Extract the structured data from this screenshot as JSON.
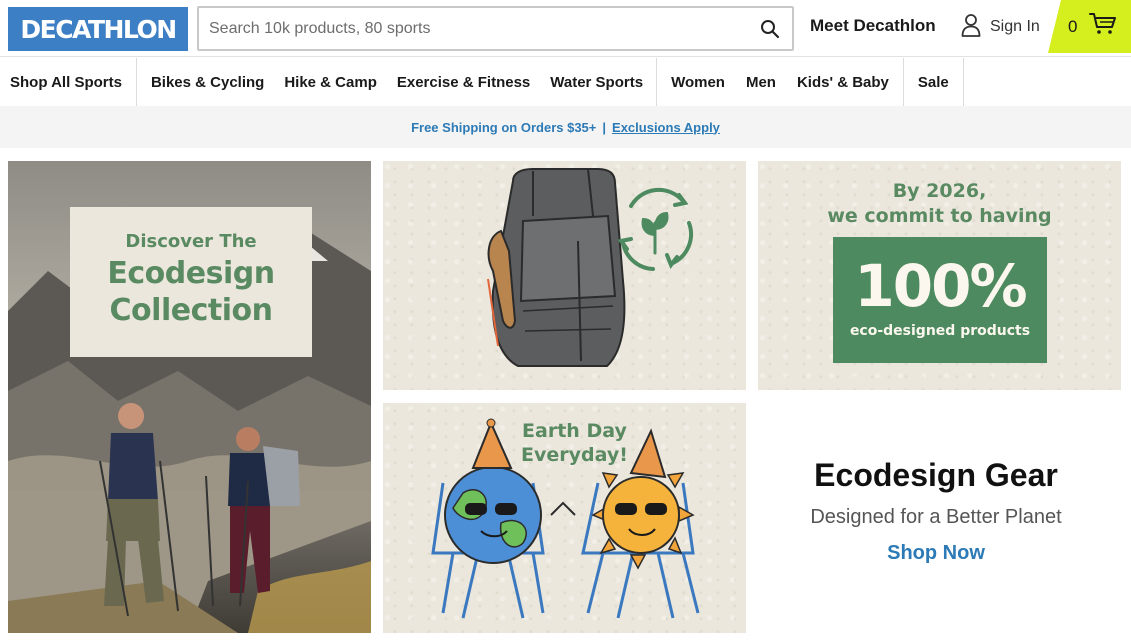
{
  "brand": {
    "logo_text": "DECATHLON",
    "accent": "#3d7fc4",
    "cart_color": "#d4ee1e"
  },
  "header": {
    "search_placeholder": "Search 10k products, 80 sports",
    "search_icon": "search-icon",
    "meet": "Meet Decathlon",
    "signin": "Sign In",
    "user_icon": "user-icon",
    "cart_count": "0",
    "cart_icon": "cart-icon"
  },
  "nav": {
    "items": [
      "Shop All Sports",
      "Bikes & Cycling",
      "Hike & Camp",
      "Exercise & Fitness",
      "Water Sports",
      "Women",
      "Men",
      "Kids' & Baby",
      "Sale"
    ]
  },
  "promo": {
    "text": "Free Shipping on Orders $35+",
    "separator": "|",
    "link": "Exclusions Apply"
  },
  "tiles": {
    "collection": {
      "line1": "Discover The",
      "line2": "Ecodesign",
      "line3": "Collection"
    },
    "commit": {
      "line1": "By 2026,",
      "line2": "we commit to having",
      "pct": "100%",
      "sub": "eco-designed products"
    },
    "earthday": {
      "line1": "Earth Day",
      "line2": "Everyday!"
    }
  },
  "promo_block": {
    "heading": "Ecodesign Gear",
    "subheading": "Designed for a Better Planet",
    "cta": "Shop Now"
  }
}
